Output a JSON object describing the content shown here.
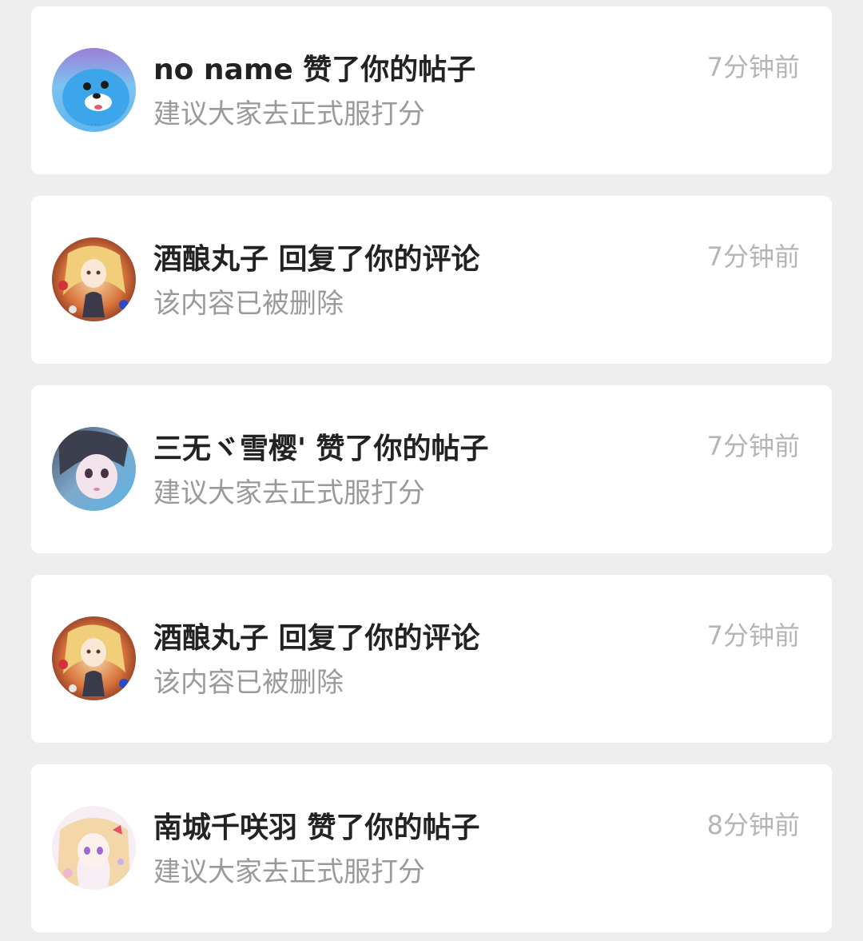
{
  "notifications": [
    {
      "avatar_icon": "blue-seal-avatar",
      "title": "no name 赞了你的帖子",
      "subtitle": "建议大家去正式服打分",
      "time": "7分钟前"
    },
    {
      "avatar_icon": "anime-girl-red-avatar",
      "title": "酒酿丸子 回复了你的评论",
      "subtitle": "该内容已被删除",
      "time": "7分钟前"
    },
    {
      "avatar_icon": "anime-girl-blue-avatar",
      "title": "三无ヾ雪樱' 赞了你的帖子",
      "subtitle": "建议大家去正式服打分",
      "time": "7分钟前"
    },
    {
      "avatar_icon": "anime-girl-red-avatar",
      "title": "酒酿丸子 回复了你的评论",
      "subtitle": "该内容已被删除",
      "time": "7分钟前"
    },
    {
      "avatar_icon": "anime-girl-pink-avatar",
      "title": "南城千咲羽 赞了你的帖子",
      "subtitle": "建议大家去正式服打分",
      "time": "8分钟前"
    }
  ],
  "colors": {
    "background": "#eeeeee",
    "card": "#ffffff",
    "title": "#222222",
    "subtitle": "#9a9a9a",
    "time": "#b5b5b5"
  }
}
